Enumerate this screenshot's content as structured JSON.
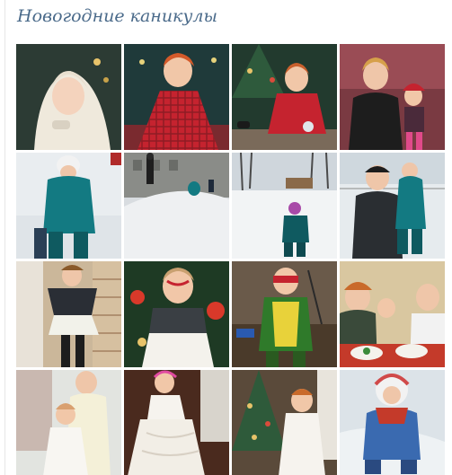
{
  "album": {
    "title": "Новогодние каникулы"
  },
  "photos": [
    {
      "subject": "girl in white knitted shawl"
    },
    {
      "subject": "girl in red plaid dress by christmas tree"
    },
    {
      "subject": "girl sitting in red plaid dress under tree"
    },
    {
      "subject": "woman with child in red hat"
    },
    {
      "subject": "child in teal snowsuit in snow"
    },
    {
      "subject": "snowy hill with people"
    },
    {
      "subject": "child on snowy field by trees"
    },
    {
      "subject": "man with child in teal snowsuit"
    },
    {
      "subject": "girl in black and white dress on stairs"
    },
    {
      "subject": "girl with face paint in gray dress"
    },
    {
      "subject": "child in colorful costume with mask"
    },
    {
      "subject": "family at table"
    },
    {
      "subject": "man holding child in white dress"
    },
    {
      "subject": "girl in white dress with pink tiara"
    },
    {
      "subject": "girl in white dress by christmas tree"
    },
    {
      "subject": "child in blue suit with scarf in snow"
    }
  ]
}
